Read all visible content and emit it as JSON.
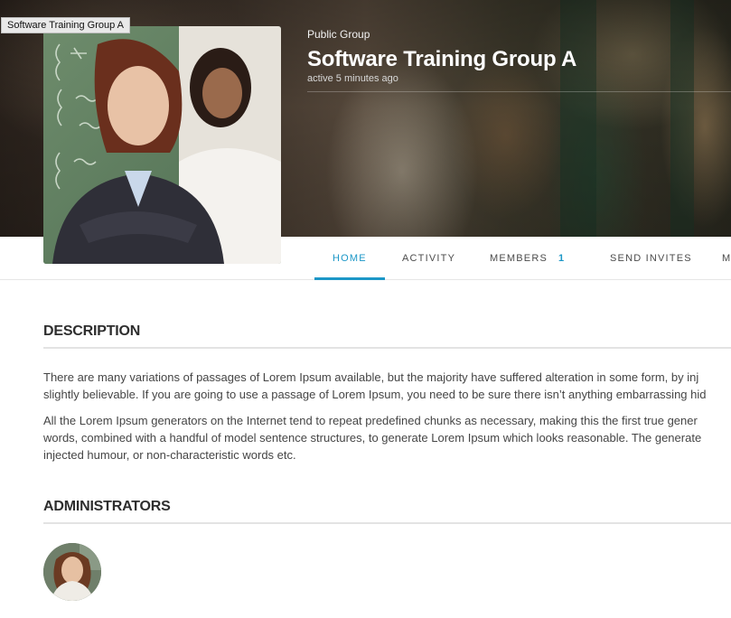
{
  "tooltip": "Software Training Group A",
  "header": {
    "group_type": "Public Group",
    "group_name": "Software Training Group A",
    "activity": "active 5 minutes ago"
  },
  "nav": {
    "home": "HOME",
    "activity": "ACTIVITY",
    "members": "MEMBERS",
    "members_count": "1",
    "send_invites": "SEND INVITES",
    "more": "M"
  },
  "description": {
    "title": "DESCRIPTION",
    "para1_line1": "There are many variations of passages of Lorem Ipsum available, but the majority have suffered alteration in some form, by inj",
    "para1_line2": "slightly believable. If you are going to use a passage of Lorem Ipsum, you need to be sure there isn’t anything embarrassing hid",
    "para2_line1": "All the Lorem Ipsum generators on the Internet tend to repeat predefined chunks as necessary, making this the first true gener",
    "para2_line2": "words, combined with a handful of model sentence structures, to generate Lorem Ipsum which looks reasonable. The generate",
    "para2_line3": "injected humour, or non-characteristic words etc."
  },
  "administrators": {
    "title": "ADMINISTRATORS"
  },
  "colors": {
    "accent": "#1c97c7",
    "text": "#454545"
  }
}
